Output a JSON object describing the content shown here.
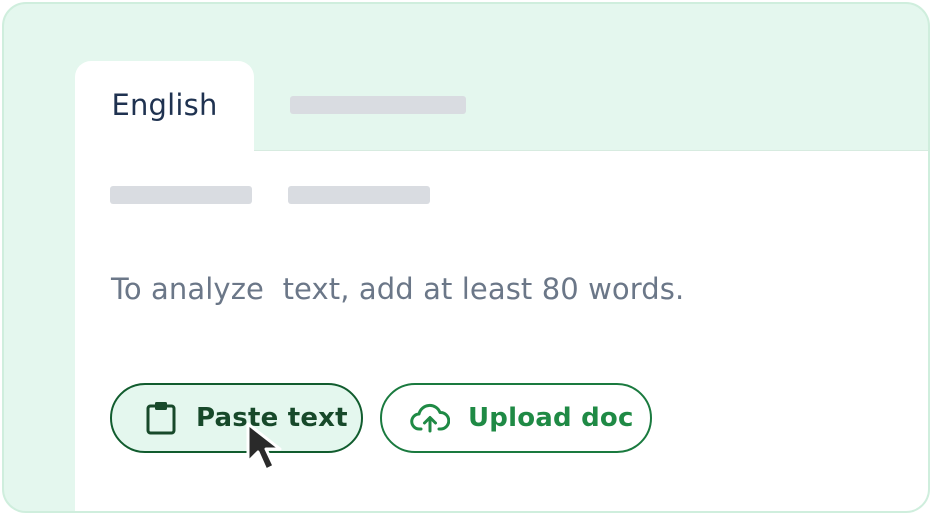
{
  "tabs": [
    {
      "label": "English",
      "active": true
    },
    {
      "label": "",
      "active": false
    }
  ],
  "editor": {
    "hint": "To analyze  text, add at least 80 words."
  },
  "actions": {
    "paste_label": "Paste text",
    "upload_label": "Upload doc"
  },
  "icons": {
    "paste": "clipboard-icon",
    "upload": "cloud-upload-icon",
    "cursor": "mouse-pointer-icon"
  },
  "colors": {
    "frame_bg": "#e4f7ee",
    "brand_green": "#1f8a45",
    "dark_green": "#17492a",
    "text_muted": "#6b7788",
    "tab_text": "#1f3250"
  }
}
